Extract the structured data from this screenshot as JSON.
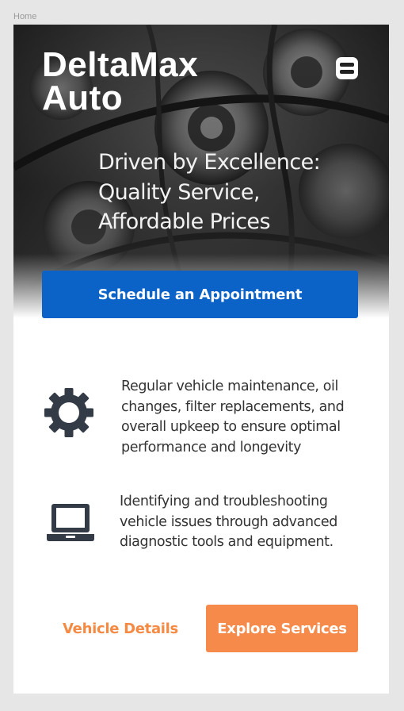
{
  "frame": {
    "label": "Home"
  },
  "header": {
    "brand_line1": "DeltaMax",
    "brand_line2": "Auto",
    "menu_icon": "menu-icon"
  },
  "hero": {
    "tagline_line1": "Driven by Excellence:",
    "tagline_line2": "Quality Service,",
    "tagline_line3": "Affordable Prices",
    "cta_label": "Schedule an Appointment"
  },
  "services": [
    {
      "icon": "gear-icon",
      "lines": [
        "Regular vehicle maintenance, oil",
        "changes, filter replacements, and",
        "overall upkeep to ensure optimal",
        "performance and longevity"
      ]
    },
    {
      "icon": "laptop-icon",
      "lines": [
        "Identifying and troubleshooting",
        "vehicle issues through advanced",
        "diagnostic tools and equipment."
      ]
    }
  ],
  "actions": {
    "secondary_label": "Vehicle Details",
    "primary_label": "Explore Services"
  },
  "colors": {
    "primary_blue": "#0b63c8",
    "accent_orange": "#f58a4b",
    "icon_dark": "#333b47",
    "text": "#333333"
  }
}
